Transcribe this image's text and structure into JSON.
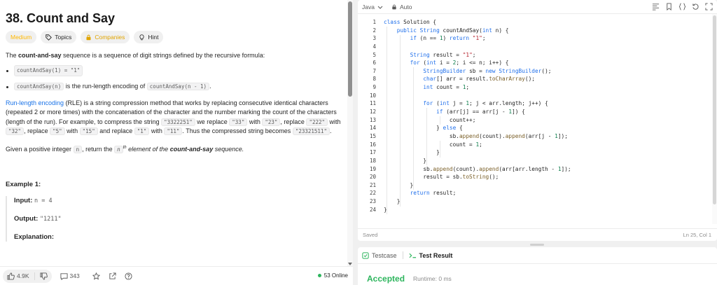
{
  "problem": {
    "title": "38. Count and Say",
    "tags": {
      "difficulty": "Medium",
      "topics": "Topics",
      "companies": "Companies",
      "hint": "Hint"
    },
    "intro_pre": "The ",
    "intro_bold": "count-and-say",
    "intro_post": " sequence is a sequence of digit strings defined by the recursive formula:",
    "bullet1_code": "countAndSay(1) = \"1\"",
    "bullet2_code": "countAndSay(n)",
    "bullet2_text": " is the run-length encoding of ",
    "bullet2_code2": "countAndSay(n - 1)",
    "bullet2_end": ".",
    "rle_link": "Run-length encoding",
    "rle_text1": " (RLE) is a string compression method that works by replacing consecutive identical characters (repeated 2 or more times) with the concatenation of the character and the number marking the count of the characters (length of the run). For example, to compress the string ",
    "rle_c1": "\"3322251\"",
    "rle_t2": " we replace ",
    "rle_c2": "\"33\"",
    "rle_t3": " with ",
    "rle_c3": "\"23\"",
    "rle_t4": ", replace ",
    "rle_c4": "\"222\"",
    "rle_t5": " with ",
    "rle_c5": "\"32\"",
    "rle_t6": ", replace ",
    "rle_c6": "\"5\"",
    "rle_t7": " with ",
    "rle_c7": "\"15\"",
    "rle_t8": " and replace ",
    "rle_c8": "\"1\"",
    "rle_t9": " with ",
    "rle_c9": "\"11\"",
    "rle_t10": ". Thus the compressed string becomes ",
    "rle_c10": "\"23321511\"",
    "rle_t11": ".",
    "given_pre": "Given a positive integer ",
    "given_code": "n",
    "given_mid": ", return the ",
    "given_italic_n": "n",
    "given_sup": "th",
    "given_italic": " element of the ",
    "given_bold": "count-and-say",
    "given_end": " sequence.",
    "example_heading": "Example 1:",
    "input_label": "Input:",
    "input_value": "n = 4",
    "output_label": "Output:",
    "output_value": "\"1211\"",
    "explanation_label": "Explanation:"
  },
  "footer": {
    "likes": "4.9K",
    "comments": "343",
    "online": "53 Online"
  },
  "editor": {
    "language": "Java",
    "mode": "Auto",
    "status_saved": "Saved",
    "cursor_position": "Ln 25, Col 1",
    "line_numbers": [
      "1",
      "2",
      "3",
      "4",
      "5",
      "6",
      "7",
      "8",
      "9",
      "10",
      "11",
      "12",
      "13",
      "14",
      "15",
      "16",
      "17",
      "18",
      "19",
      "20",
      "21",
      "22",
      "23",
      "24"
    ],
    "code_lines": [
      "class Solution {",
      "    public String countAndSay(int n) {",
      "        if (n == 1) return \"1\";",
      "",
      "        String result = \"1\";",
      "        for (int i = 2; i <= n; i++) {",
      "            StringBuilder sb = new StringBuilder();",
      "            char[] arr = result.toCharArray();",
      "            int count = 1;",
      "",
      "            for (int j = 1; j < arr.length; j++) {",
      "                if (arr[j] == arr[j - 1]) {",
      "                    count++;",
      "                } else {",
      "                    sb.append(count).append(arr[j - 1]);",
      "                    count = 1;",
      "                }",
      "            }",
      "            sb.append(count).append(arr[arr.length - 1]);",
      "            result = sb.toString();",
      "        }",
      "        return result;",
      "    }",
      "}"
    ]
  },
  "console": {
    "tab_testcase": "Testcase",
    "tab_result": "Test Result",
    "verdict": "Accepted",
    "runtime": "Runtime: 0 ms"
  }
}
